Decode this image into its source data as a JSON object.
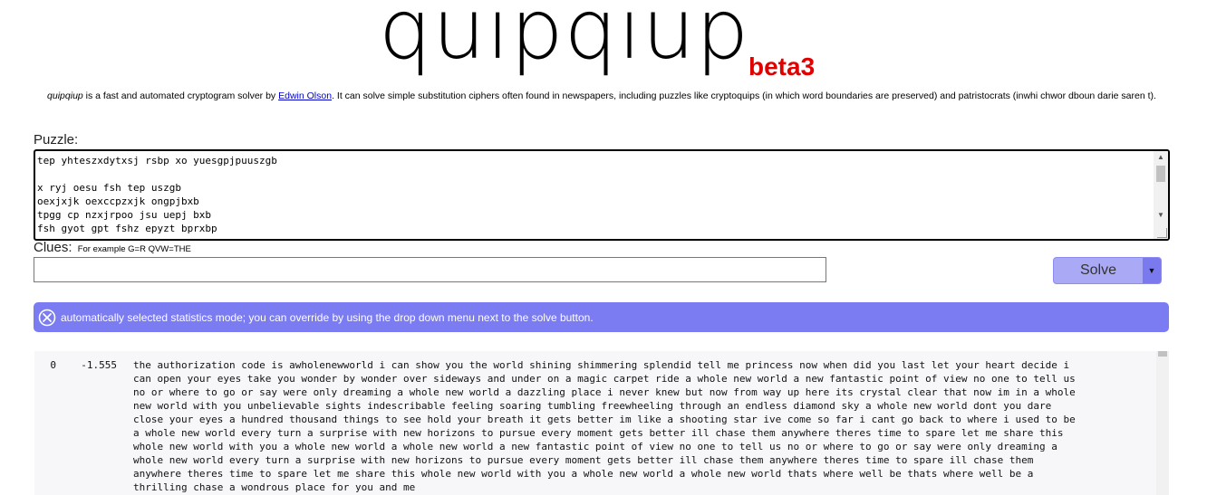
{
  "header": {
    "logo": "quipqiup",
    "beta": "beta3"
  },
  "description": {
    "app_name": "quipqiup",
    "text_before_link": " is a fast and automated cryptogram solver by ",
    "author_link": "Edwin Olson",
    "text_after_link": ". It can solve simple substitution ciphers often found in newspapers, including puzzles like cryptoquips (in which word boundaries are preserved) and patristocrats (inwhi chwor dboun darie saren t)."
  },
  "puzzle": {
    "label": "Puzzle:",
    "value": "tep yhteszxdytxsj rsbp xo yuesgpjpuuszgb\n\nx ryj oesu fsh tep uszgb\noexjxjk oexccpzxjk ongpjbxb\ntpgg cp nzxjrpoo jsu uepj bxb\nfsh gyot gpt fshz epyzt bprxbp"
  },
  "clues": {
    "label": "Clues:",
    "hint": "For example G=R QVW=THE",
    "value": ""
  },
  "solve": {
    "label": "Solve",
    "dropdown_arrow": "▼"
  },
  "status": {
    "icon": "close-circle-icon",
    "message": "automatically selected statistics mode; you can override by using the drop down menu next to the solve button."
  },
  "results": [
    {
      "index": "0",
      "score": "-1.555",
      "text": "the authorization code is awholenewworld i can show you the world shining shimmering splendid tell me princess now when did you last let your heart decide i\ncan open your eyes take you wonder by wonder over sideways and under on a magic carpet ride a whole new world a new fantastic point of view no one to tell us\nno or where to go or say were only dreaming a whole new world a dazzling place i never knew but now from way up here its crystal clear that now im in a whole\nnew world with you unbelievable sights indescribable feeling soaring tumbling freewheeling through an endless diamond sky a whole new world dont you dare\nclose your eyes a hundred thousand things to see hold your breath it gets better im like a shooting star ive come so far i cant go back to where i used to be\na whole new world every turn a surprise with new horizons to pursue every moment gets better ill chase them anywhere theres time to spare let me share this\nwhole new world with you a whole new world a whole new world a new fantastic point of view no one to tell us no or where to go or say were only dreaming a\nwhole new world every turn a surprise with new horizons to pursue every moment gets better ill chase them anywhere theres time to spare ill chase them\nanywhere theres time to spare let me share this whole new world with you a whole new world a whole new world thats where well be thats where well be a\nthrilling chase a wondrous place for you and me"
    }
  ],
  "colors": {
    "accent": "#7b7bf2",
    "beta": "#e00000",
    "link": "#0000cc"
  }
}
